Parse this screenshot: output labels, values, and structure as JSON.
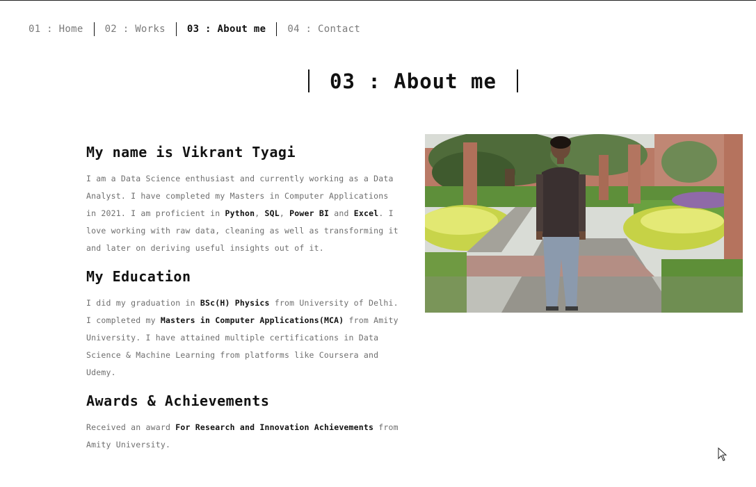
{
  "nav": {
    "items": [
      {
        "label": "01 : Home",
        "active": false
      },
      {
        "label": "02 : Works",
        "active": false
      },
      {
        "label": "03 : About me",
        "active": true
      },
      {
        "label": "04 : Contact",
        "active": false
      }
    ]
  },
  "page": {
    "title": "03 : About me"
  },
  "about": {
    "heading": "My name is Vikrant Tyagi",
    "p1": "I am a Data Science enthusiast and currently working as a Data Analyst. I have completed my Masters in Computer Applications in 2021. I am proficient in ",
    "skill_python": "Python",
    "sep1": ", ",
    "skill_sql": "SQL",
    "sep2": ", ",
    "skill_powerbi": "Power BI",
    "sep3": " and ",
    "skill_excel": "Excel",
    "p2": ". I love working with raw data, cleaning as well as transforming it and later on deriving useful insights out of it."
  },
  "education": {
    "heading": "My Education",
    "t1": "I did my graduation in ",
    "degree1": "BSc(H) Physics",
    "t2": " from University of Delhi. I completed my ",
    "degree2": "Masters in Computer Applications(MCA)",
    "t3": " from Amity University. I have attained multiple certifications in Data Science & Machine Learning from platforms like Coursera and Udemy."
  },
  "awards": {
    "heading": "Awards & Achievements",
    "t1": "Received an award ",
    "award": "For Research and Innovation Achievements",
    "t2": " from Amity University."
  },
  "photo": {
    "icon": "profile-photo"
  },
  "colors": {
    "text": "#111111",
    "muted": "#6e6e6e",
    "nav_inactive": "#7a7a7a",
    "background": "#ffffff"
  }
}
